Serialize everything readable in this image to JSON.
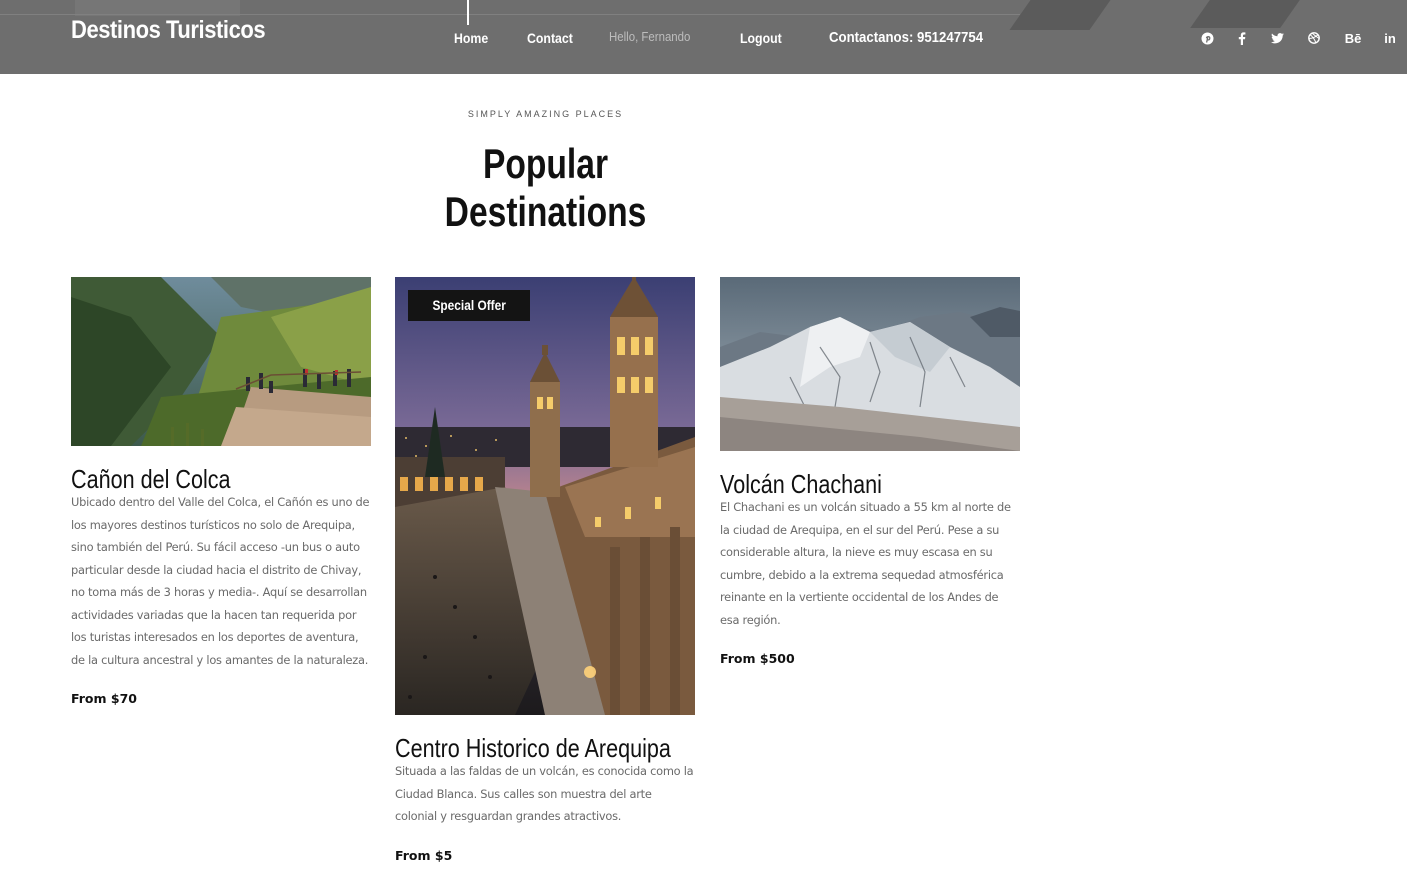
{
  "header": {
    "brand": "Destinos Turisticos",
    "nav": {
      "home": "Home",
      "contact": "Contact",
      "greeting": "Hello, Fernando",
      "logout": "Logout",
      "phone": "Contactanos: 951247754"
    },
    "social": [
      {
        "icon": "pinterest-icon",
        "glyph": "℗"
      },
      {
        "icon": "facebook-icon",
        "glyph": "f"
      },
      {
        "icon": "twitter-icon",
        "glyph": "❀"
      },
      {
        "icon": "dribbble-icon",
        "glyph": "❂"
      },
      {
        "icon": "behance-icon",
        "glyph": "Bē"
      },
      {
        "icon": "linkedin-icon",
        "glyph": "in"
      }
    ]
  },
  "section": {
    "eyebrow": "Simply Amazing Places",
    "title": "Popular Destinations"
  },
  "cards": [
    {
      "title": "Cañon del Colca",
      "description": "Ubicado dentro del Valle del Colca, el Cañón es uno de los mayores destinos turísticos no solo de Arequipa, sino también del Perú. Su fácil acceso -un bus o auto particular desde la ciudad hacia el distrito de Chivay, no toma más de 3 horas y media-. Aquí se desarrollan actividades variadas que la hacen tan requerida por los turistas interesados en los deportes de aventura, de la cultura ancestral y los amantes de la naturaleza.",
      "price": "From $70"
    },
    {
      "badge": "Special Offer",
      "title": "Centro Historico de Arequipa",
      "description": "Situada a las faldas de un volcán, es conocida como la Ciudad Blanca. Sus calles son muestra del arte colonial y resguardan grandes atractivos.",
      "price": "From $5"
    },
    {
      "title": "Volcán Chachani",
      "description": "El Chachani es un volcán situado a 55 km al norte de la ciudad de Arequipa, en el sur del Perú. Pese a su considerable altura, la nieve es muy escasa en su cumbre, debido a la extrema sequedad atmosférica reinante en la vertiente occidental de los Andes de esa región.",
      "price": "From $500"
    }
  ]
}
